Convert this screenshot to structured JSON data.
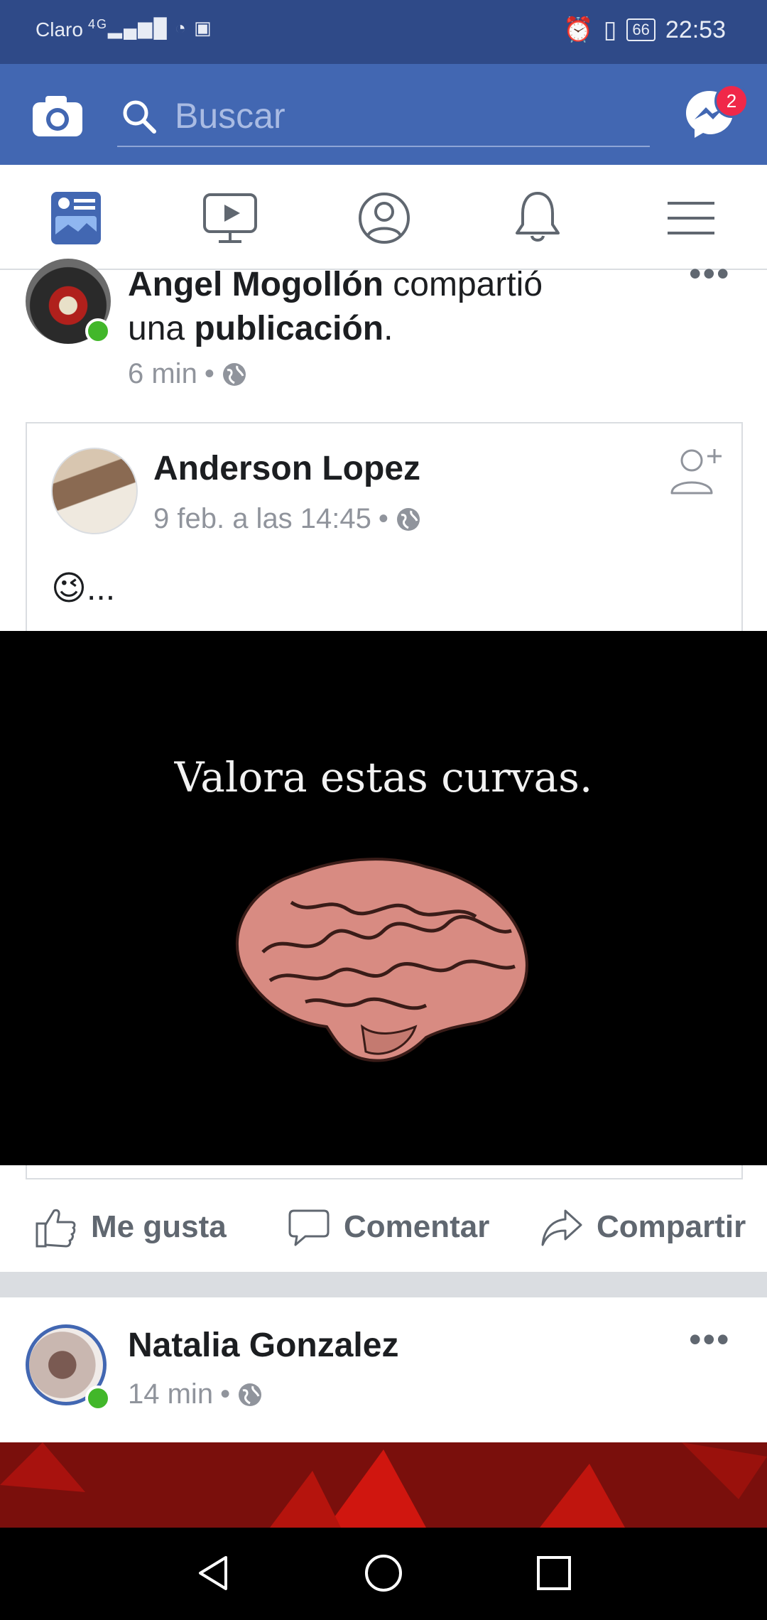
{
  "status_bar": {
    "carrier": "Claro",
    "network": "4G",
    "battery": "66",
    "time": "22:53"
  },
  "header": {
    "search_placeholder": "Buscar",
    "messenger_badge": "2"
  },
  "tabs": [
    "news-feed",
    "watch",
    "profile",
    "notifications",
    "menu"
  ],
  "post1": {
    "author": "Angel Mogollón",
    "action_text": " compartió",
    "action_line2_prefix": "una ",
    "action_line2_bold": "publicación",
    "action_line2_suffix": ".",
    "time": "6 min",
    "shared": {
      "author": "Anderson Lopez",
      "time": "9 feb. a las 14:45",
      "text": "😉...",
      "image_caption": "Valora estas curvas."
    }
  },
  "actions": {
    "like": "Me gusta",
    "comment": "Comentar",
    "share": "Compartir"
  },
  "post2": {
    "author": "Natalia Gonzalez",
    "time": "14 min"
  },
  "colors": {
    "facebook_blue": "#4267b2",
    "statusbar": "#2f4a88",
    "online_green": "#42b72a",
    "badge_red": "#f02849"
  }
}
